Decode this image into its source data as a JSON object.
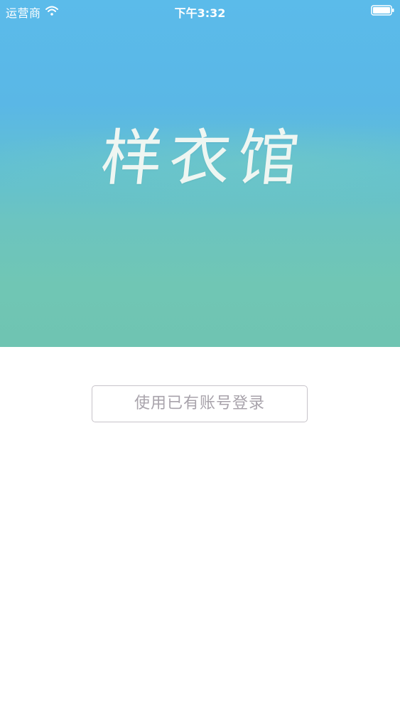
{
  "status_bar": {
    "carrier": "运营商",
    "time": "下午3:32",
    "wifi_icon": "wifi-icon",
    "battery_icon": "battery-icon"
  },
  "hero": {
    "title": "样衣馆",
    "gradient_top_color": "#5bbbea",
    "gradient_bottom_color": "#6fc4b2"
  },
  "actions": {
    "login_existing_account": "使用已有账号登录"
  }
}
